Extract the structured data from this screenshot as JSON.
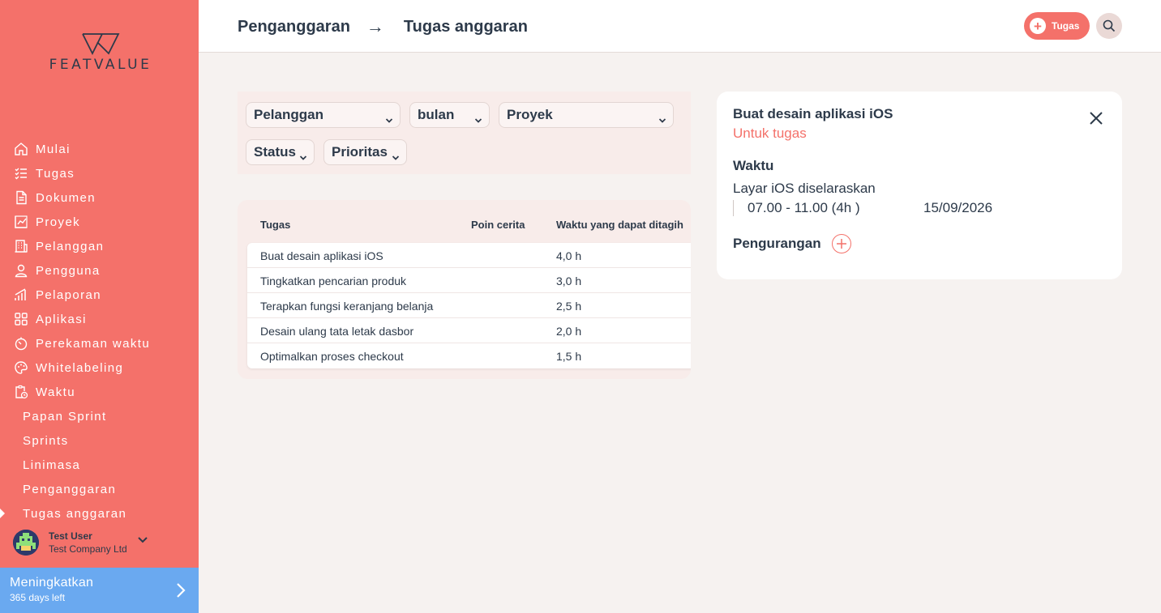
{
  "brand": {
    "name": "FEATVALUE"
  },
  "colors": {
    "accent": "#f4716a",
    "sidebar": "#f4716a",
    "upgrade": "#6aa9f0",
    "text": "#2d3a4a"
  },
  "sidebar": {
    "items": [
      {
        "label": "Mulai",
        "icon": "home-icon"
      },
      {
        "label": "Tugas",
        "icon": "checklist-icon"
      },
      {
        "label": "Dokumen",
        "icon": "document-icon"
      },
      {
        "label": "Proyek",
        "icon": "chart-icon"
      },
      {
        "label": "Pelanggan",
        "icon": "building-icon"
      },
      {
        "label": "Pengguna",
        "icon": "user-icon"
      },
      {
        "label": "Pelaporan",
        "icon": "bar-chart-icon"
      },
      {
        "label": "Aplikasi",
        "icon": "apps-icon"
      },
      {
        "label": "Perekaman waktu",
        "icon": "timer-icon"
      },
      {
        "label": "Whitelabeling",
        "icon": "palette-icon"
      },
      {
        "label": "Waktu",
        "icon": "clipboard-clock-icon"
      }
    ],
    "subitems": [
      {
        "label": "Papan Sprint"
      },
      {
        "label": "Sprints"
      },
      {
        "label": "Linimasa"
      },
      {
        "label": "Penganggaran"
      },
      {
        "label": "Tugas anggaran",
        "active": true
      }
    ],
    "user": {
      "name": "Test User",
      "company": "Test Company Ltd"
    },
    "upgrade": {
      "title": "Meningkatkan",
      "subtitle": "365 days left"
    }
  },
  "header": {
    "breadcrumb": {
      "parent": "Penganggaran",
      "separator": "→",
      "current": "Tugas anggaran"
    },
    "task_button": "Tugas"
  },
  "filters": {
    "customer": "Pelanggan",
    "month": "bulan",
    "project": "Proyek",
    "status": "Status",
    "priority": "Prioritas"
  },
  "table": {
    "columns": [
      "Tugas",
      "Poin cerita",
      "Waktu yang dapat ditagih"
    ],
    "rows": [
      {
        "task": "Buat desain aplikasi iOS",
        "points": "",
        "time": "4,0 h"
      },
      {
        "task": "Tingkatkan pencarian produk",
        "points": "",
        "time": "3,0 h"
      },
      {
        "task": "Terapkan fungsi keranjang belanja",
        "points": "",
        "time": "2,5 h"
      },
      {
        "task": "Desain ulang tata letak dasbor",
        "points": "",
        "time": "2,0 h"
      },
      {
        "task": "Optimalkan proses checkout",
        "points": "",
        "time": "1,5 h"
      }
    ]
  },
  "detail": {
    "title": "Buat desain aplikasi iOS",
    "subtitle": "Untuk tugas",
    "time_heading": "Waktu",
    "entry_name": "Layar iOS diselaraskan",
    "entry_time": "07.00 - 11.00 (4h )",
    "entry_date": "15/09/2026",
    "deductions_label": "Pengurangan"
  }
}
